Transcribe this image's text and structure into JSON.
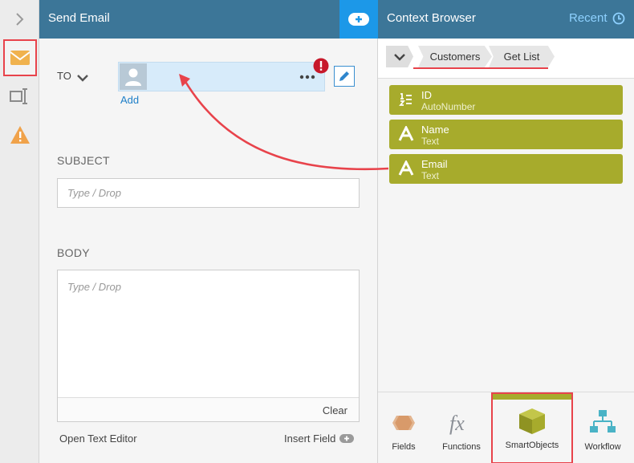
{
  "send_email": {
    "title": "Send Email",
    "to_label": "TO",
    "add_label": "Add",
    "subject_label": "SUBJECT",
    "subject_placeholder": "Type / Drop",
    "body_label": "BODY",
    "body_placeholder": "Type / Drop",
    "clear_label": "Clear",
    "open_text_editor_label": "Open Text Editor",
    "insert_field_label": "Insert Field"
  },
  "context_browser": {
    "title": "Context Browser",
    "recent_label": "Recent",
    "breadcrumbs": [
      "Customers",
      "Get List"
    ],
    "fields": [
      {
        "name": "ID",
        "type": "AutoNumber",
        "icon": "autonumber-icon"
      },
      {
        "name": "Name",
        "type": "Text",
        "icon": "text-type-icon"
      },
      {
        "name": "Email",
        "type": "Text",
        "icon": "text-type-icon"
      }
    ],
    "tabs": [
      {
        "label": "Fields",
        "icon": "fields-icon"
      },
      {
        "label": "Functions",
        "icon": "functions-icon"
      },
      {
        "label": "SmartObjects",
        "icon": "smartobjects-icon",
        "active": true
      },
      {
        "label": "Workflow",
        "icon": "workflow-icon"
      }
    ]
  },
  "colors": {
    "header": "#3c7698",
    "accent": "#1c98e8",
    "field_pill": "#a7ab2c",
    "highlight": "#e8434b"
  }
}
